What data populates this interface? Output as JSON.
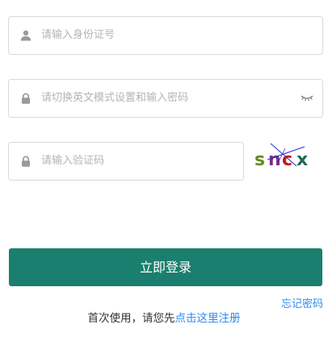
{
  "form": {
    "id_field": {
      "placeholder": "请输入身份证号",
      "icon": "user-icon"
    },
    "password_field": {
      "placeholder": "请切换英文模式设置和输入密码",
      "icon": "lock-icon",
      "toggle_icon": "eye-closed-icon"
    },
    "captcha_field": {
      "placeholder": "请输入验证码",
      "icon": "lock-icon"
    },
    "captcha": {
      "chars": [
        "s",
        "n",
        "c",
        "x"
      ],
      "colors": [
        "#6a8a1e",
        "#7a2a8a",
        "#c01a1a",
        "#1e6a5a"
      ]
    },
    "login_button": "立即登录",
    "forgot_password": "忘记密码"
  },
  "footer": {
    "prefix": "首次使用，请您先",
    "register_link": "点击这里注册"
  },
  "colors": {
    "primary": "#1a7f6e",
    "link": "#2d8cf0",
    "placeholder": "#b4b4b4",
    "border": "#d9d9d9"
  }
}
